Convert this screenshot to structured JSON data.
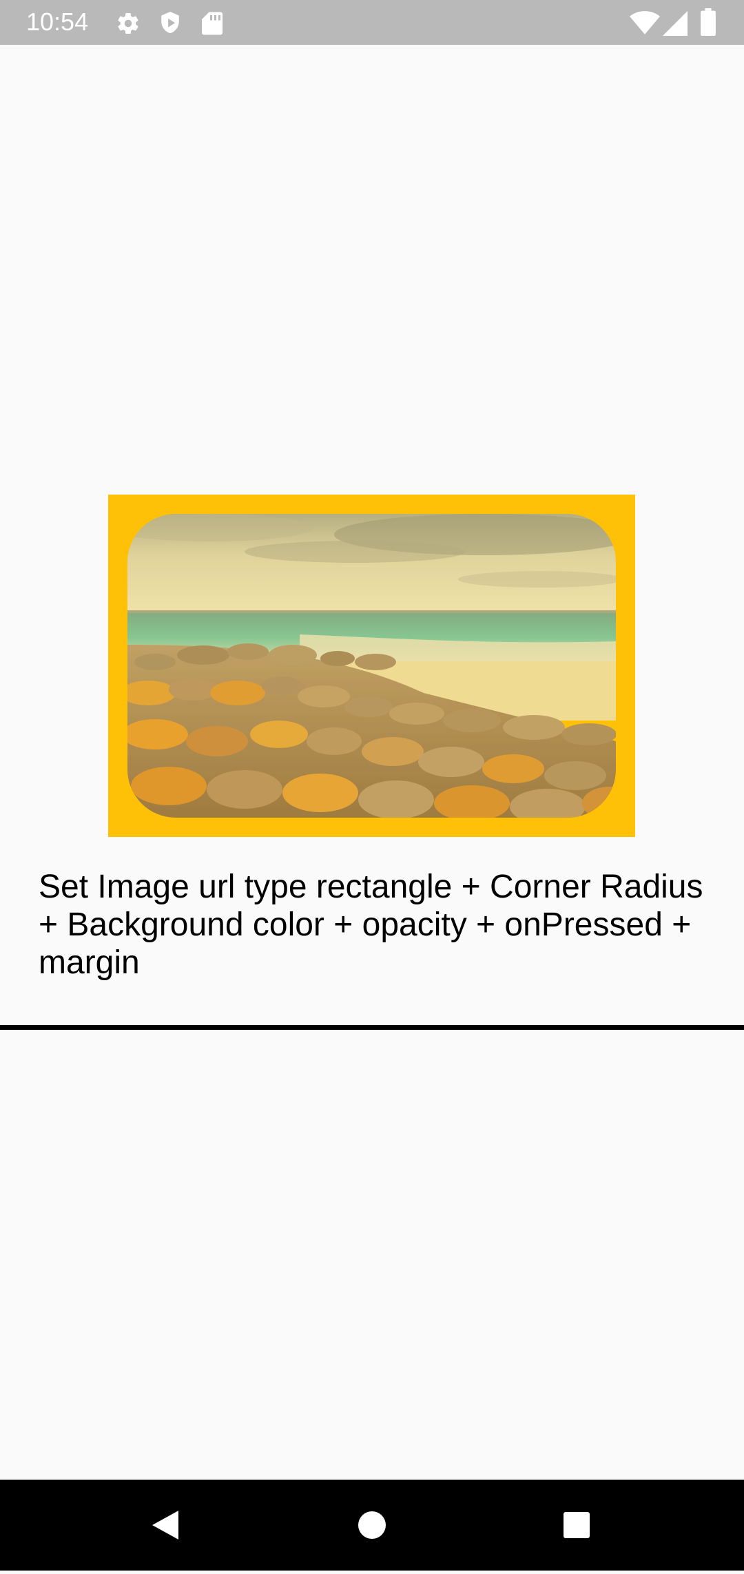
{
  "status_bar": {
    "time": "10:54",
    "background": "#b9b9b9",
    "left_icons": [
      "gear-icon",
      "shield-icon",
      "sd-card-icon"
    ],
    "right_icons": [
      "wifi-icon",
      "signal-icon",
      "battery-icon"
    ]
  },
  "image_card": {
    "image_alt": "Rocky beach with orange lichen-covered boulders and turquoise sea under a cloudy sky",
    "frame_color": "#ffc107"
  },
  "caption": {
    "text": "Set Image url type rectangle + Corner Radius + Background color + opacity + onPressed + margin"
  },
  "nav_bar": {
    "back_icon": "back-triangle-icon",
    "home_icon": "home-circle-icon",
    "recents_icon": "recents-square-icon"
  }
}
